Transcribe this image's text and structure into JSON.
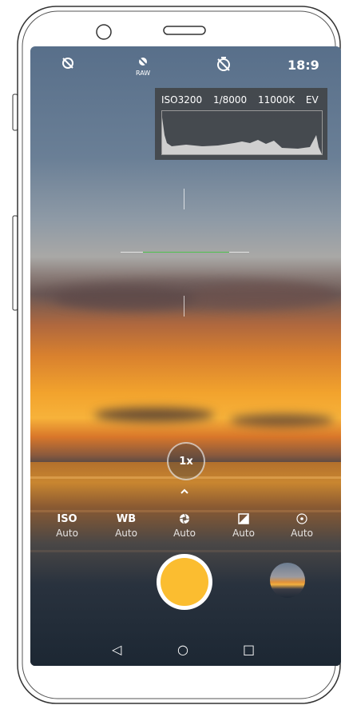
{
  "status_bar": {
    "icons": [
      "no-rotate-icon",
      "raw-icon",
      "timer-off-icon"
    ],
    "raw_label": "RAW",
    "aspect_ratio": "18:9"
  },
  "histogram": {
    "iso": "ISO3200",
    "shutter": "1/8000",
    "white_balance": "11000K",
    "ev": "EV"
  },
  "zoom": {
    "label": "1x"
  },
  "controls": [
    {
      "label": "ISO",
      "value": "Auto"
    },
    {
      "label": "WB",
      "value": "Auto"
    },
    {
      "label": "",
      "icon": "aperture-icon",
      "value": "Auto"
    },
    {
      "label": "",
      "icon": "exposure-icon",
      "value": "Auto"
    },
    {
      "label": "",
      "icon": "focus-icon",
      "value": "Auto"
    }
  ],
  "colors": {
    "shutter": "#fbbd30"
  },
  "nav": {
    "back": "◁",
    "home": "○",
    "recents": "□"
  }
}
